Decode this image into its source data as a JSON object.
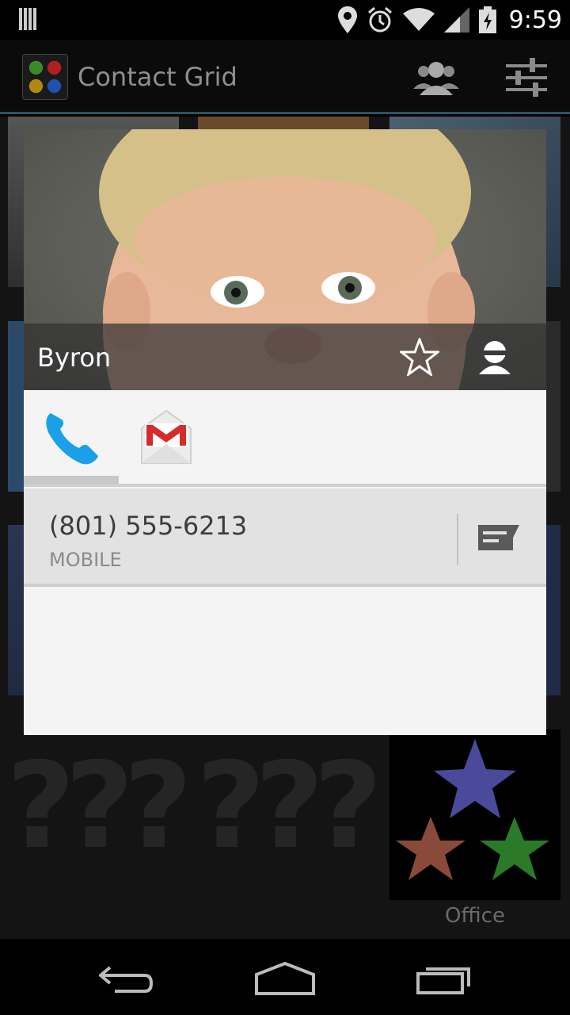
{
  "status_bar": {
    "time": "9:59",
    "icons": [
      "notification-bars-icon",
      "location-icon",
      "alarm-icon",
      "wifi-icon",
      "signal-icon",
      "battery-charging-icon"
    ]
  },
  "action_bar": {
    "title": "Contact Grid",
    "actions": [
      "groups-icon",
      "settings-sliders-icon"
    ]
  },
  "background_grid": {
    "office_label": "Office",
    "placeholder_glyph": "?"
  },
  "contact_card": {
    "name": "Byron",
    "tabs": [
      {
        "name": "phone-icon",
        "selected": true
      },
      {
        "name": "gmail-icon",
        "selected": false
      }
    ],
    "entries": [
      {
        "number": "(801) 555-6213",
        "type": "MOBILE",
        "action": "sms-icon"
      }
    ]
  },
  "colors": {
    "action_bar_divider": "#2b5468",
    "phone_blue": "#1aa0e8",
    "gmail_red": "#d62b2b"
  },
  "nav_bar": {
    "buttons": [
      "back-icon",
      "home-icon",
      "recents-icon"
    ]
  }
}
